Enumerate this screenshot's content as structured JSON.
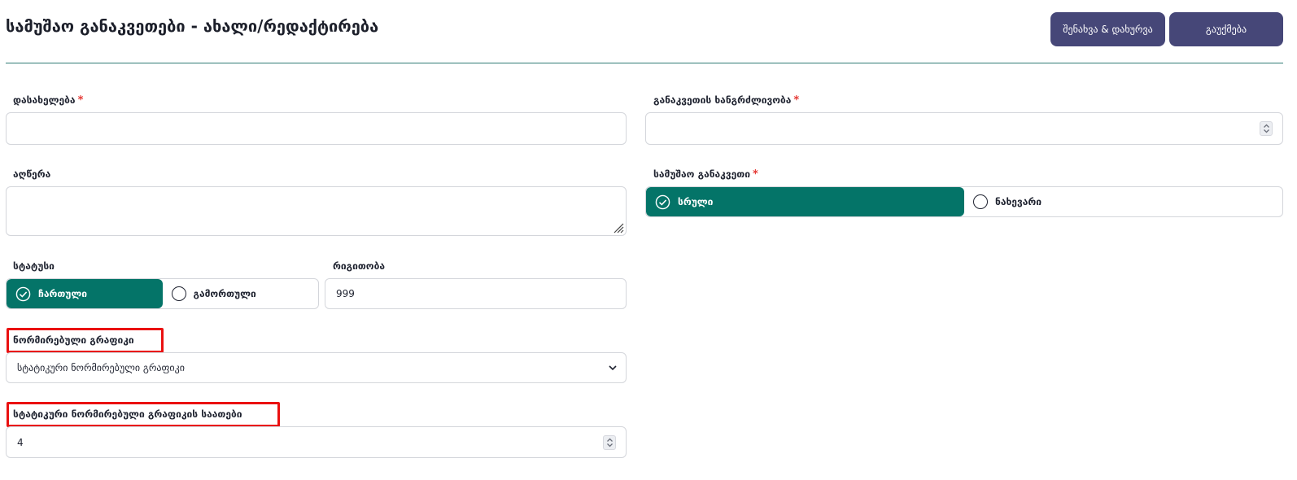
{
  "header": {
    "title": "სამუშაო განაკვეთები - ახალი/რედაქტირება",
    "save_close_label": "შენახვა & დახურვა",
    "cancel_label": "გაუქმება"
  },
  "form": {
    "name": {
      "label": "დასახელება",
      "required_mark": "*",
      "value": ""
    },
    "rate_duration": {
      "label": "განაკვეთის ხანგრძლივობა",
      "required_mark": "*",
      "value": ""
    },
    "description": {
      "label": "აღწერა",
      "value": ""
    },
    "work_rate": {
      "label": "სამუშაო განაკვეთი",
      "required_mark": "*",
      "options": [
        "სრული",
        "ნახევარი"
      ],
      "selected": "სრული"
    },
    "status": {
      "label": "სტატუსი",
      "options": [
        "ჩართული",
        "გამორთული"
      ],
      "selected": "ჩართული"
    },
    "order": {
      "label": "რიგითობა",
      "value": "999"
    },
    "normative_schedule": {
      "label": "ნორმირებული გრაფიკი",
      "selected": "სტატიკური ნორმირებული გრაფიკი"
    },
    "static_schedule_hours": {
      "label": "სტატიკური ნორმირებული გრაფიკის საათები",
      "value": "4"
    }
  },
  "colors": {
    "primary_button": "#464778",
    "active_option": "#047468",
    "divider": "#2f7b74",
    "required": "#e53935",
    "highlight": "#ea1010"
  },
  "icons": {
    "check": "check-circle-icon",
    "radio": "radio-circle-icon",
    "chevron": "chevron-down-icon",
    "stepper": "number-stepper-icon",
    "resize": "resize-grip-icon"
  }
}
